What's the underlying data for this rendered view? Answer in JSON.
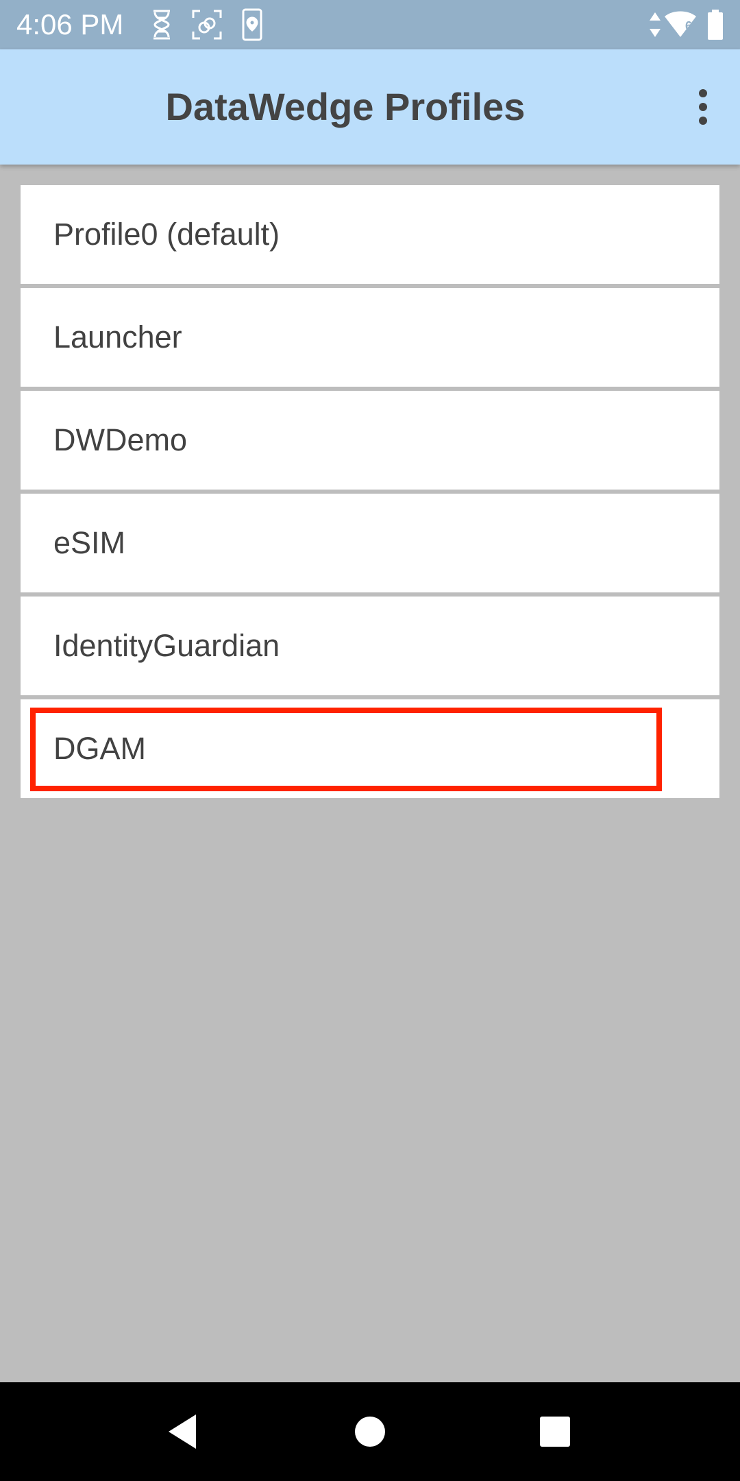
{
  "status_bar": {
    "time": "4:06 PM",
    "left_icons": [
      "dna-icon",
      "face-scan-icon",
      "phone-location-icon"
    ],
    "right_icons": [
      "data-arrows-icon",
      "wifi-icon",
      "battery-icon"
    ],
    "wifi_badge": "6"
  },
  "app_bar": {
    "title": "DataWedge Profiles",
    "overflow_icon": "more-vert-icon"
  },
  "profiles": [
    {
      "label": "Profile0 (default)"
    },
    {
      "label": "Launcher"
    },
    {
      "label": "DWDemo"
    },
    {
      "label": "eSIM"
    },
    {
      "label": "IdentityGuardian"
    },
    {
      "label": "DGAM",
      "highlighted": true
    }
  ],
  "colors": {
    "status_bar": "#93b0c8",
    "app_bar": "#bbdefb",
    "background": "#bdbdbd",
    "highlight": "#ff2200"
  },
  "nav_bar": {
    "icons": [
      "back-icon",
      "home-icon",
      "recents-icon"
    ]
  }
}
